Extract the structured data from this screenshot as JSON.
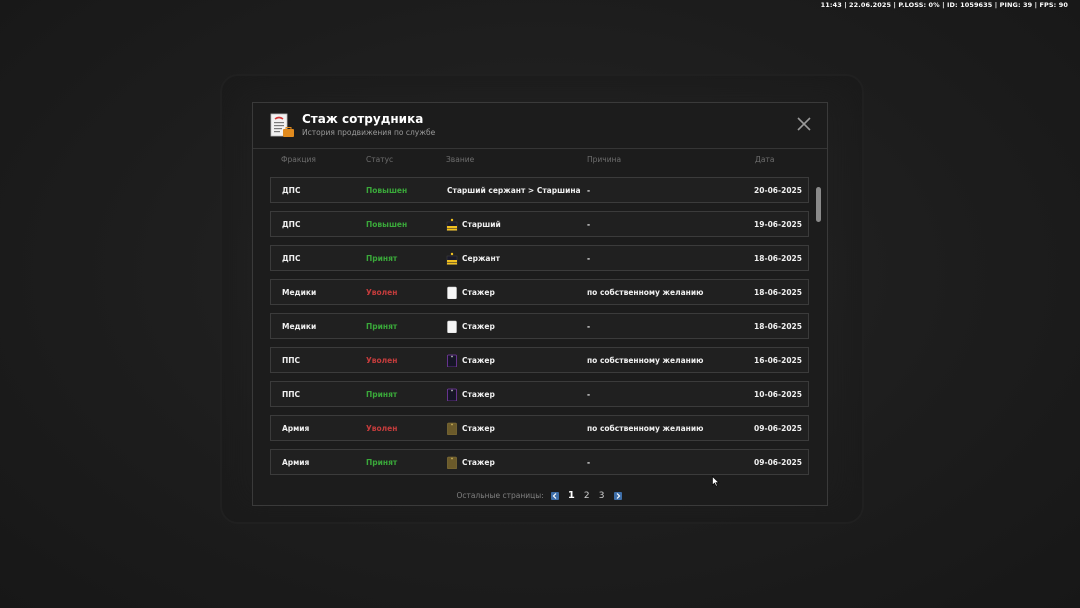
{
  "hud": {
    "text": "11:43 | 22.06.2025 | P.LOSS: 0% | ID: 1059635 | PING: 39 | FPS: 90"
  },
  "window": {
    "title": "Стаж сотрудника",
    "subtitle": "История продвижения по службе",
    "icon": "document-certificate-icon",
    "close_icon": "close-x-icon"
  },
  "columns": {
    "faction": "Фракция",
    "status": "Статус",
    "rank": "Звание",
    "reason": "Причина",
    "date": "Дата"
  },
  "rows": [
    {
      "faction": "ДПС",
      "status": "Повышен",
      "status_color": "green",
      "rank_icon": "none",
      "rank": "Старший сержант > Старшина",
      "reason": "-",
      "date": "20-06-2025"
    },
    {
      "faction": "ДПС",
      "status": "Повышен",
      "status_color": "green",
      "rank_icon": "police-insignia-icon",
      "rank": "Старший",
      "reason": "-",
      "date": "19-06-2025"
    },
    {
      "faction": "ДПС",
      "status": "Принят",
      "status_color": "green",
      "rank_icon": "police-insignia-icon",
      "rank": "Сержант",
      "reason": "-",
      "date": "18-06-2025"
    },
    {
      "faction": "Медики",
      "status": "Уволен",
      "status_color": "red",
      "rank_icon": "medic-insignia-icon",
      "rank": "Стажер",
      "reason": "по собственному желанию",
      "date": "18-06-2025"
    },
    {
      "faction": "Медики",
      "status": "Принят",
      "status_color": "green",
      "rank_icon": "medic-insignia-icon",
      "rank": "Стажер",
      "reason": "-",
      "date": "18-06-2025"
    },
    {
      "faction": "ППС",
      "status": "Уволен",
      "status_color": "red",
      "rank_icon": "pps-insignia-icon",
      "rank": "Стажер",
      "reason": "по собственному желанию",
      "date": "16-06-2025"
    },
    {
      "faction": "ППС",
      "status": "Принят",
      "status_color": "green",
      "rank_icon": "pps-insignia-icon",
      "rank": "Стажер",
      "reason": "-",
      "date": "10-06-2025"
    },
    {
      "faction": "Армия",
      "status": "Уволен",
      "status_color": "red",
      "rank_icon": "army-insignia-icon",
      "rank": "Стажер",
      "reason": "по собственному желанию",
      "date": "09-06-2025"
    },
    {
      "faction": "Армия",
      "status": "Принят",
      "status_color": "green",
      "rank_icon": "army-insignia-icon",
      "rank": "Стажер",
      "reason": "-",
      "date": "09-06-2025"
    }
  ],
  "pager": {
    "label": "Остальные страницы:",
    "pages": [
      "1",
      "2",
      "3"
    ],
    "current": "1",
    "prev_icon": "chevron-left-icon",
    "next_icon": "chevron-right-icon"
  },
  "colors": {
    "status_green": "#3aa83a",
    "status_red": "#c43c3c",
    "pager_arrow": "#3e6ea8"
  }
}
